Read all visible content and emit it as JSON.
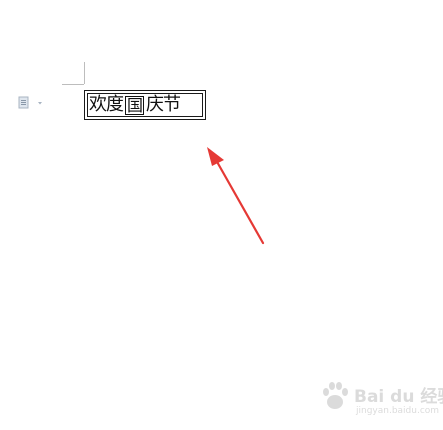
{
  "document": {
    "text_box": {
      "part1": "欢度",
      "part2": "国",
      "part3": "庆节"
    }
  },
  "annotation": {
    "arrow_color": "#e53935"
  },
  "watermark": {
    "logo_text": "Bai du 经验",
    "sub_text": "jingyan.baidu.com"
  },
  "icons": {
    "paragraph_icon": "paste-options-icon",
    "arrow_icon": "red-arrow-icon"
  }
}
